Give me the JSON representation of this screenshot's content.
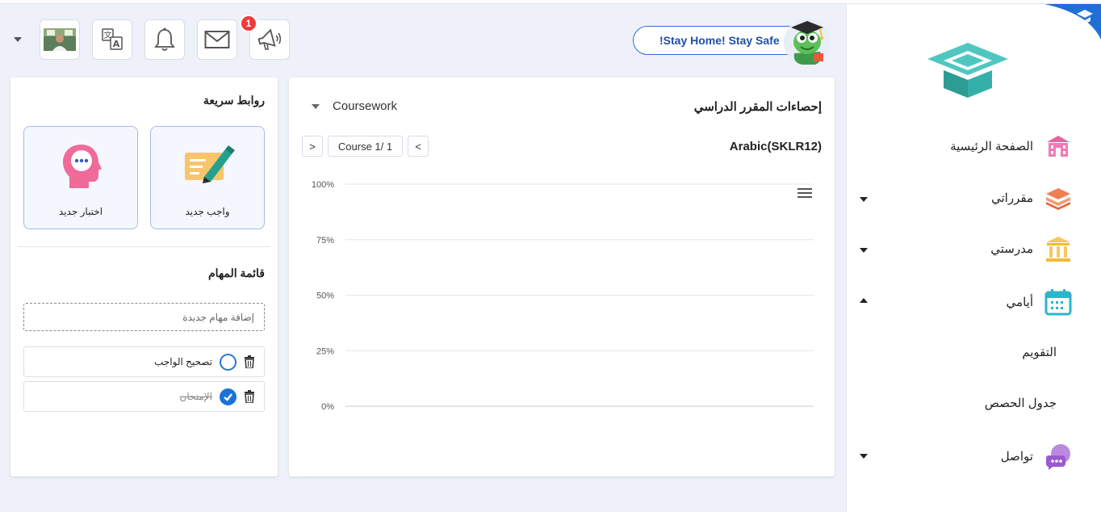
{
  "header": {
    "stay_home_text": "!Stay Home! Stay Safe",
    "notification_count": "1",
    "icons": [
      "avatar",
      "translate-icon",
      "bell-icon",
      "mail-icon",
      "megaphone-icon"
    ]
  },
  "sidebar": {
    "items": [
      {
        "label": "الصفحة الرئيسية",
        "icon": "home-icon",
        "color": "#ec5fa0"
      },
      {
        "label": "مقرراتي",
        "icon": "books-icon",
        "color": "#f07e55"
      },
      {
        "label": "مدرستي",
        "icon": "school-icon",
        "color": "#f6c85f"
      },
      {
        "label": "أيامي",
        "icon": "calendar-icon",
        "color": "#2bb5c9"
      },
      {
        "label": "تواصل",
        "icon": "chat-icon",
        "color": "#9b59d0"
      }
    ],
    "subitems": [
      "التقويم",
      "جدول الحصص"
    ]
  },
  "stats": {
    "title": "إحصاءات المقرر الدراسي",
    "dropdown_value": "Coursework",
    "course_name": "Arabic(SKLR12)",
    "pager_label": "Course 1/ 1",
    "prev_label": "<",
    "next_label": ">"
  },
  "chart_data": {
    "type": "bar",
    "categories": [],
    "values": [],
    "yticks": [
      "100%",
      "75%",
      "50%",
      "25%",
      "0%"
    ],
    "ylim": [
      0,
      100
    ],
    "grid": true
  },
  "quick_links": {
    "title": "روابط سريعة",
    "tiles": [
      {
        "label": "واجب جديد",
        "icon": "pen-note-icon"
      },
      {
        "label": "اختبار جديد",
        "icon": "head-chat-icon"
      }
    ]
  },
  "tasks": {
    "title": "قائمة المهام",
    "input_placeholder": "إضافة مهام جديدة",
    "items": [
      {
        "text": "تصحيح الواجب",
        "done": false
      },
      {
        "text": "الإمتحان",
        "done": true
      }
    ]
  },
  "colors": {
    "accent": "#2a6fd6",
    "badge": "#ef3b3b",
    "tile_border": "#a9b8f0",
    "logo": "#4fc7c0"
  }
}
